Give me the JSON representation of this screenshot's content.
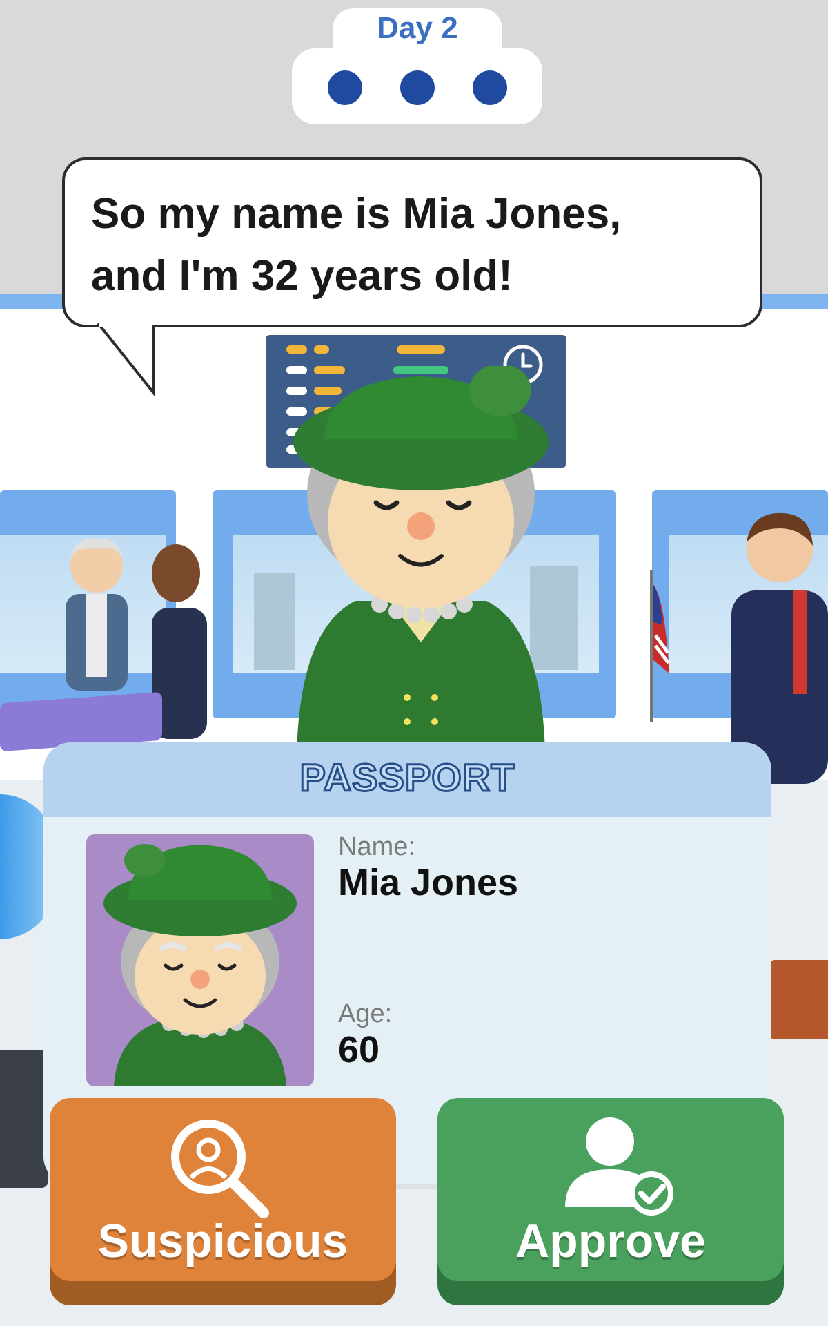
{
  "day": {
    "label": "Day 2",
    "dots": 3
  },
  "speech": {
    "line1": "So my name is Mia Jones,",
    "line2": "and I'm 32 years old!"
  },
  "passport": {
    "title": "PASSPORT",
    "name_label": "Name:",
    "name_value": "Mia Jones",
    "age_label": "Age:",
    "age_value": "60"
  },
  "actions": {
    "suspicious_label": "Suspicious",
    "approve_label": "Approve"
  },
  "icons": {
    "suspicious": "magnifier-person-icon",
    "approve": "person-check-icon"
  },
  "colors": {
    "suspicious": "#e0833a",
    "approve": "#4aa15e",
    "passport_header": "#b7d2ee",
    "day_dots": "#1f4aa0"
  }
}
